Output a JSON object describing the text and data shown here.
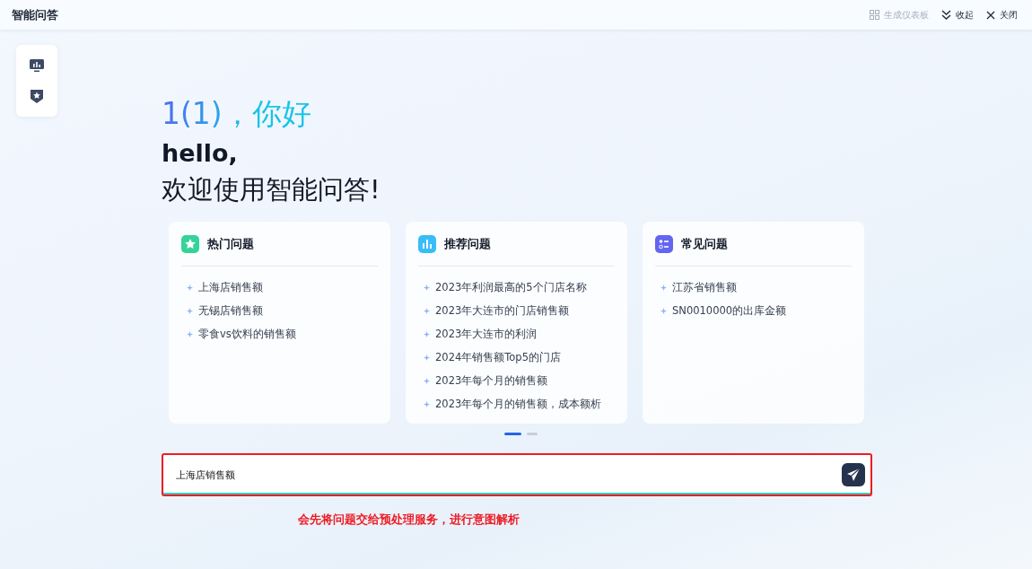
{
  "header": {
    "title": "智能问答",
    "actions": [
      {
        "kind": "dashboard",
        "label": "生成仪表板",
        "disabled": true
      },
      {
        "kind": "collapse",
        "label": "收起",
        "disabled": false
      },
      {
        "kind": "close",
        "label": "关闭",
        "disabled": false
      }
    ]
  },
  "side_toolbar": [
    {
      "kind": "chart"
    },
    {
      "kind": "star"
    }
  ],
  "greeting": {
    "name": "1(1)，你好",
    "line_1": "hello,",
    "line_2": "欢迎使用智能问答!"
  },
  "cards": [
    {
      "kind": "star",
      "color": "#34d399",
      "title": "热门问题",
      "items": [
        "上海店销售额",
        "无锡店销售额",
        "零食vs饮料的销售额"
      ]
    },
    {
      "kind": "bars",
      "color": "#38bdf8",
      "title": "推荐问题",
      "items": [
        "2023年利润最高的5个门店名称",
        "2023年大连市的门店销售额",
        "2023年大连市的利润",
        "2024年销售额Top5的门店",
        "2023年每个月的销售额",
        "2023年每个月的销售额，成本额析"
      ]
    },
    {
      "kind": "list",
      "color": "#6366f1",
      "title": "常见问题",
      "items": [
        "江苏省销售额",
        "SN0010000的出库金额"
      ]
    }
  ],
  "pager": [
    {
      "selected": true
    },
    {
      "selected": false
    }
  ],
  "question_input": {
    "value": "上海店销售额"
  },
  "annotation": "会先将问题交给预处理服务，进行意图解析"
}
